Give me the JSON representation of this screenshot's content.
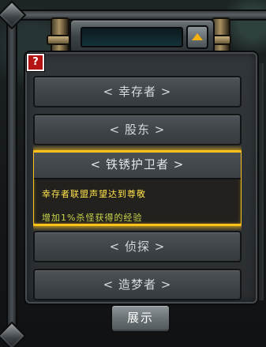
{
  "title": {
    "text": ""
  },
  "help": {
    "label": "?"
  },
  "list": {
    "items": [
      {
        "label": "< 幸存者 >"
      },
      {
        "label": "< 股东 >"
      },
      {
        "label": "< 铁锈护卫者 >",
        "selected": true,
        "description": [
          "幸存者联盟声望达到尊敬",
          "增加1%杀怪获得的经验"
        ]
      },
      {
        "label": "< 侦探 >"
      },
      {
        "label": "< 造梦者 >"
      }
    ]
  },
  "footer": {
    "show_label": "展示"
  },
  "colors": {
    "selected_border": "#ffc21a",
    "desc_primary": "#ffe24a",
    "desc_secondary": "#c9d64a",
    "help_red": "#b41414",
    "arrow_accent": "#f5b10e"
  },
  "icons": {
    "title_arrow": "up-arrow-icon",
    "help": "question-mark-icon"
  }
}
